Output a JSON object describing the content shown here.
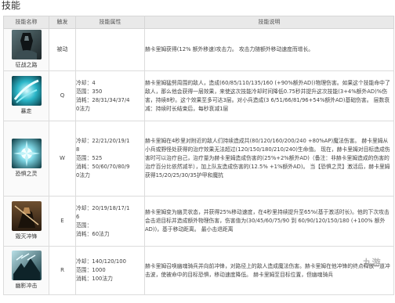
{
  "title": "技能",
  "columns": [
    "技能名称",
    "触发",
    "技能属性",
    "技能说明"
  ],
  "skills": [
    {
      "name": "征战之路",
      "icon": "dark-armored-knight-icon",
      "key": "被动",
      "attrs": [],
      "desc": "赫卡里姆获得(12% 额外移速)攻击力。 攻击力随额外移动速度而增长。"
    },
    {
      "name": "暴走",
      "icon": "cyan-spear-swirl-icon",
      "key": "Q",
      "attrs": [
        "冷却：4",
        "范围：350",
        "消耗：28/31/34/37/4",
        "0法力"
      ],
      "desc": "赫卡里姆猛劈周围的敌人，造成(60/85/110/135/160 (+90%额外AD))物理伤害。如果这个技能命中了敌人，那么他会获得一层效果，来使这次技能冷却时间降低0.75秒并提升这次技能(3+4%额外AD)%伤害，持续8秒。这个效果至多可达3层。对小兵造成(3 6/51/66/81/96+54%额外AD)基础伤害。 层数衰减：持续时长结束后，每秒衰减1层"
    },
    {
      "name": "恐惧之灵",
      "icon": "spirit-burst-icon",
      "key": "W",
      "attrs": [
        "冷却：22/21/20/19/1",
        "8",
        "范围：525",
        "消耗：50/60/70/80/9",
        "0法力"
      ],
      "desc": "赫卡里姆在4秒里对附近的敌人们持续造成共(80/120/160/200/240 +80%AP)魔法伤害。 赫卡里姆从小兵或野怪处获得的治疗效果无法超过(120/150/180/210/240)生命值。 现在，赫卡里姆对目标造成伤害时可以治疗自己，治疗量为赫卡里姆造成伤害的(25%+2%额外AD)（备注：非赫卡里姆造成的伤害的治疗百分比依然减半），加上队友造成伤害的(12.5% +1%额外AD)。 当【恐惧之灵】激活后，赫卡里姆获得15/20/25/30/35护甲和魔抗"
    },
    {
      "name": "毁灭冲锋",
      "icon": "charging-rider-icon",
      "key": "E",
      "attrs": [
        "冷却：20/19/18/17/1",
        "6",
        "范围：",
        "消耗：60法力"
      ],
      "desc": "赫卡里姆变为幽灵状态，并获得25%移动速度，在4秒里持续提升至65%(基于激活时长)。他的下次攻击会击退目标并造成额外物理伤害，伤害值为(30/45/60/75/90 到 60/90/120/150/180 (+100% 额外AD))，基于移动距离。 最小击退距离"
    },
    {
      "name": "幽影冲击",
      "icon": "shadow-cavalry-icon",
      "key": "R",
      "attrs": [
        "冷却：140/120/100",
        "范围：1000",
        "消耗：100法力"
      ],
      "desc": "赫卡里姆召唤幽魂骑兵并向前冲锋，对路径上的敌人造成魔法伤害。赫卡里姆在他冲锋的终点释放一道冲击波，使被命中的目标恐惧，移动速度降低。 赫卡里姆至目标位置，但幽魂骑兵"
    }
  ],
  "watermark": "九游"
}
